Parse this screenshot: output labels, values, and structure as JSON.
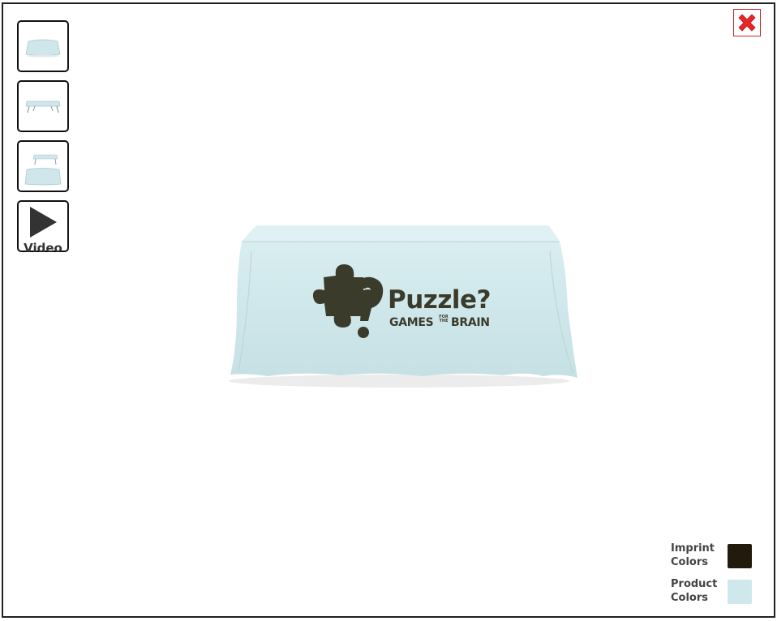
{
  "modal": {
    "close": {
      "icon": "close-x-icon",
      "color": "#e8262a"
    },
    "thumbnails": [
      {
        "kind": "image",
        "label": ""
      },
      {
        "kind": "image",
        "label": ""
      },
      {
        "kind": "image",
        "label": ""
      },
      {
        "kind": "video",
        "label": "Video",
        "icon": "play-icon"
      }
    ],
    "product_image": {
      "logo_line1": "Puzzle?",
      "logo_line2_a": "GAMES",
      "logo_line2_small": "FOR THE",
      "logo_line2_b": "BRAIN",
      "cloth_color": "#cfe6ea",
      "imprint_color": "#3b3b2c"
    },
    "legend": {
      "imprint_label": "Imprint Colors",
      "product_label": "Product Colors",
      "imprint_swatch": "#231a0e",
      "product_swatch": "#cfe8ec"
    }
  }
}
